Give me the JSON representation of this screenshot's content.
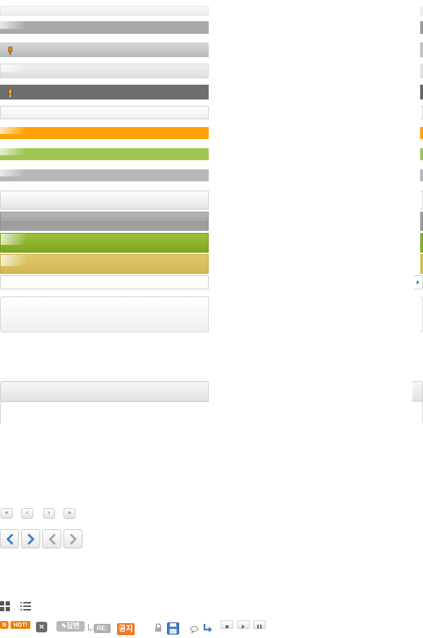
{
  "colors": {
    "orange": "#ffa200",
    "light_green": "#9dc653",
    "dark_gray": "#6e6e6e",
    "olive_green": "#88b02a",
    "gold": "#d9c05c",
    "blue_icon": "#3d7dc8",
    "new_badge": "#f07d00",
    "hot_badge": "#f07d00",
    "notice_badge": "#ea7a2a",
    "gray_badge": "#b0b0b0"
  },
  "pager": {
    "first_label": "«",
    "prev_label": "‹",
    "next_label": "›",
    "last_label": "»"
  },
  "badges": {
    "new_label": "N",
    "hot_label": "HOT!",
    "close_label": "×",
    "reply_label": "답변",
    "re_label": "RE:",
    "notice_label": "공지"
  },
  "icons": {
    "pin": "pin-icon",
    "grid_view": "grid-view-icon",
    "list_view": "list-view-icon",
    "lock": "lock-icon",
    "save": "save-icon",
    "comment": "comment-icon",
    "reply_arrow": "reply-arrow-icon",
    "stop": "stop-icon",
    "play": "play-icon",
    "pause": "pause-icon",
    "right_arrow": "arrow-right-icon",
    "nav_prev_blue": "chevron-left-blue-icon",
    "nav_next_blue": "chevron-right-blue-icon",
    "nav_prev_gray": "chevron-left-gray-icon",
    "nav_next_gray": "chevron-right-gray-icon"
  }
}
